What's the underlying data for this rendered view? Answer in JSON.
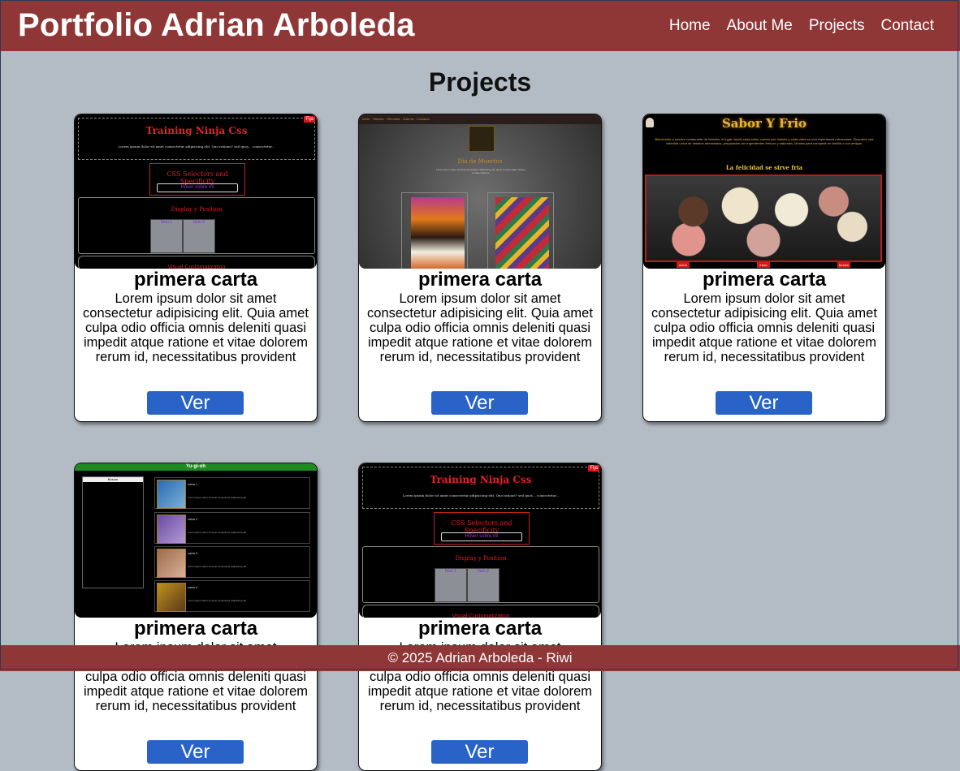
{
  "header": {
    "title": "Portfolio Adrian Arboleda",
    "nav": [
      "Home",
      "About Me",
      "Projects",
      "Contact"
    ]
  },
  "section_title": "Projects",
  "cards": [
    {
      "title": "primera carta",
      "text": "Lorem ipsum dolor sit amet consectetur adipisicing elit. Quia amet culpa odio officia omnis deleniti quasi impedit atque ratione et vitae dolorem rerum id, necessitatibus provident",
      "button": "Ver"
    },
    {
      "title": "primera carta",
      "text": "Lorem ipsum dolor sit amet consectetur adipisicing elit. Quia amet culpa odio officia omnis deleniti quasi impedit atque ratione et vitae dolorem rerum id, necessitatibus provident",
      "button": "Ver"
    },
    {
      "title": "primera carta",
      "text": "Lorem ipsum dolor sit amet consectetur adipisicing elit. Quia amet culpa odio officia omnis deleniti quasi impedit atque ratione et vitae dolorem rerum id, necessitatibus provident",
      "button": "Ver"
    },
    {
      "title": "primera carta",
      "text": "Lorem ipsum dolor sit amet consectetur adipisicing elit. Quia amet culpa odio officia omnis deleniti quasi impedit atque ratione et vitae dolorem rerum id, necessitatibus provident",
      "button": "Ver"
    },
    {
      "title": "primera carta",
      "text": "Lorem ipsum dolor sit amet consectetur adipisicing elit. Quia amet culpa odio officia omnis deleniti quasi impedit atque ratione et vitae dolorem rerum id, necessitatibus provident",
      "button": "Ver"
    }
  ],
  "thumbs": {
    "ninja": {
      "title": "Training Ninja Css",
      "fija": "Fija",
      "selectors": "CSS Selectors and Specificity",
      "selectors_btn": "Hover sobre mí",
      "display": "Display y Position",
      "item1": "Item 1",
      "item2": "Item 2",
      "visual": "Visual Customatization"
    },
    "sabor": {
      "title": "Sabor Y Frio",
      "text": "Bienvenido a nuestro restaurante de helados, el lugar donde cada sabor cuenta una historia y cada visita es una experiencia refrescante. Descubre una variedad única de helados artesanales, preparados con ingredientes frescos y naturales, ideales para compartir en familia o con amigos.",
      "subtitle": "La felicidad se sirve fria",
      "buttons": [
        "menu",
        "inicio",
        "fondos"
      ]
    },
    "yugioh": {
      "title": "Yu-gi-oh",
      "cards": [
        "carta 1",
        "carta 2",
        "carta 3",
        "carta 4"
      ]
    }
  },
  "footer": "© 2025 Adrian Arboleda - Riwi"
}
